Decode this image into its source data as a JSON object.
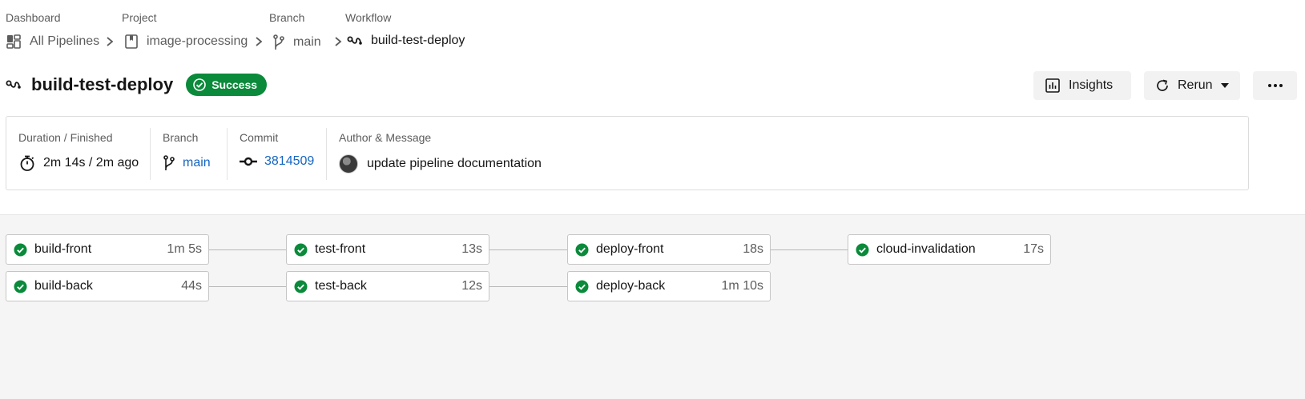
{
  "breadcrumb": {
    "dashboard": {
      "label": "Dashboard",
      "value": "All Pipelines"
    },
    "project": {
      "label": "Project",
      "value": "image-processing"
    },
    "branch": {
      "label": "Branch",
      "value": "main"
    },
    "workflow": {
      "label": "Workflow",
      "value": "build-test-deploy"
    }
  },
  "header": {
    "title": "build-test-deploy",
    "status": "Success",
    "status_color": "#0a8a3a",
    "actions": {
      "insights": "Insights",
      "rerun": "Rerun",
      "more": "more-icon"
    }
  },
  "info": {
    "duration": {
      "label": "Duration / Finished",
      "value": "2m 14s / 2m ago"
    },
    "branch": {
      "label": "Branch",
      "value": "main"
    },
    "commit": {
      "label": "Commit",
      "value": "3814509"
    },
    "author": {
      "label": "Author & Message",
      "value": "update pipeline documentation"
    },
    "link_color": "#1565c0"
  },
  "jobs": {
    "build_front": {
      "name": "build-front",
      "duration": "1m 5s",
      "status": "success"
    },
    "build_back": {
      "name": "build-back",
      "duration": "44s",
      "status": "success"
    },
    "test_front": {
      "name": "test-front",
      "duration": "13s",
      "status": "success"
    },
    "test_back": {
      "name": "test-back",
      "duration": "12s",
      "status": "success"
    },
    "deploy_front": {
      "name": "deploy-front",
      "duration": "18s",
      "status": "success"
    },
    "deploy_back": {
      "name": "deploy-back",
      "duration": "1m 10s",
      "status": "success"
    },
    "cloud_invalidation": {
      "name": "cloud-invalidation",
      "duration": "17s",
      "status": "success"
    }
  }
}
